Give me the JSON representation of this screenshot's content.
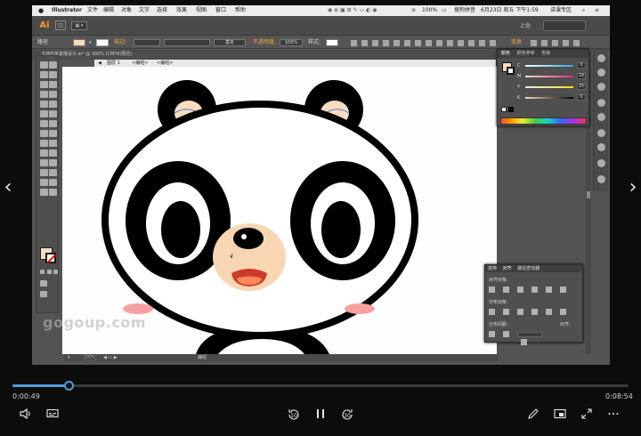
{
  "mac_menubar": {
    "app": "Illustrator",
    "items": [
      "文件",
      "编辑",
      "对象",
      "文字",
      "选择",
      "效果",
      "视图",
      "窗口",
      "帮助"
    ],
    "battery": "100%",
    "input_method": "搜狗拼音",
    "datetime": "6月23日 周五 下午1:59",
    "speaker": "讲课专区"
  },
  "ai_app": {
    "logo": "Ai",
    "user": "上色",
    "workspace": "变换"
  },
  "control_bar": {
    "selection_type": "路径",
    "stroke_label": "描边:",
    "brush_label": "基本",
    "opacity_label": "不透明度:",
    "opacity_value": "100%",
    "style_label": "样式:",
    "transform_label": "变换"
  },
  "document": {
    "tab_title": "卡通形象素描设计.ai* @ 300% (CMYK/预览)",
    "breadcrumbs": [
      "图层 1",
      "<编组>",
      "<编组>"
    ]
  },
  "color_panel": {
    "tabs": [
      "颜色",
      "颜色参考",
      "色板"
    ],
    "channels": [
      {
        "label": "C",
        "value": "0",
        "color": "#2aa7e0"
      },
      {
        "label": "M",
        "value": "16",
        "color": "#e0287a"
      },
      {
        "label": "Y",
        "value": "25",
        "color": "#f4e01a"
      },
      {
        "label": "K",
        "value": "0",
        "color": "#000000"
      }
    ],
    "fill_color": "#f8dcbf"
  },
  "align_panel": {
    "tabs": [
      "变换",
      "对齐",
      "路径查找器"
    ],
    "align_objects_label": "对齐对象:",
    "distribute_objects_label": "分布对象:",
    "distribute_spacing_label": "分布间距:",
    "align_to_label": "对齐:"
  },
  "status_bar": {
    "zoom": "300%",
    "tool": "编组"
  },
  "watermark": "gogoup.com",
  "player": {
    "current_time": "0:00:49",
    "total_time": "0:08:54",
    "progress": 0.092,
    "skip_back": "10",
    "skip_forward": "30",
    "accent_color": "#4d9de0"
  }
}
